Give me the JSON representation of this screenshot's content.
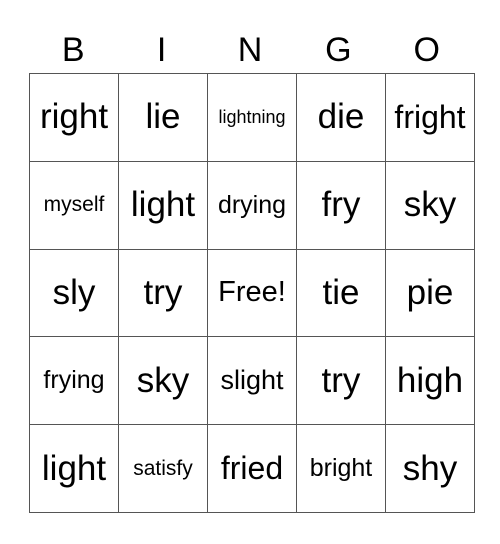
{
  "header": [
    "B",
    "I",
    "N",
    "G",
    "O"
  ],
  "rows": [
    [
      "right",
      "lie",
      "lightning",
      "die",
      "fright"
    ],
    [
      "myself",
      "light",
      "drying",
      "fry",
      "sky"
    ],
    [
      "sly",
      "try",
      "Free!",
      "tie",
      "pie"
    ],
    [
      "frying",
      "sky",
      "slight",
      "try",
      "high"
    ],
    [
      "light",
      "satisfy",
      "fried",
      "bright",
      "shy"
    ]
  ]
}
